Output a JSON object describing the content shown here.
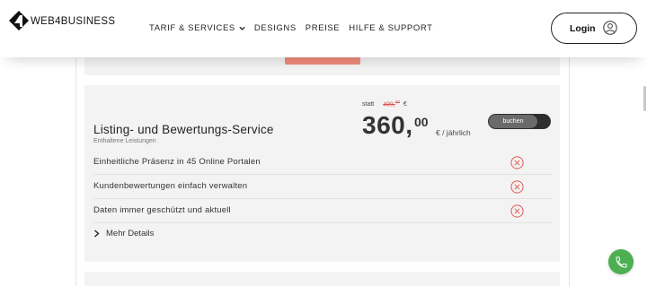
{
  "header": {
    "logo_text": "WEB4BUSINESS",
    "nav": [
      {
        "label": "TARIF & SERVICES"
      },
      {
        "label": "DESIGNS"
      },
      {
        "label": "PREISE"
      },
      {
        "label": "HILFE & SUPPORT"
      }
    ],
    "login_label": "Login"
  },
  "product": {
    "title": "Listing- und Bewertungs-Service",
    "subtitle": "Enthaltene Leistungen",
    "statt_label": "statt",
    "old_price": "499,",
    "old_price_cents": "00",
    "old_price_currency": "€",
    "price_main": "360,",
    "price_cents": "00",
    "price_unit": "€ / jährlich",
    "book_label": "buchen",
    "features": [
      {
        "label": "Einheitliche Präsenz in 45 Online Portalen",
        "icon": "x-circle-icon"
      },
      {
        "label": "Kundenbewertungen einfach verwalten",
        "icon": "x-circle-icon"
      },
      {
        "label": "Daten immer geschützt und aktuell",
        "icon": "x-circle-icon"
      }
    ],
    "details_label": "Mehr Details"
  },
  "colors": {
    "accent_red": "#e05a4f",
    "button_dark": "#2e2e2e",
    "phone_green": "#4caf50",
    "card_bg": "#f3f3f3"
  }
}
